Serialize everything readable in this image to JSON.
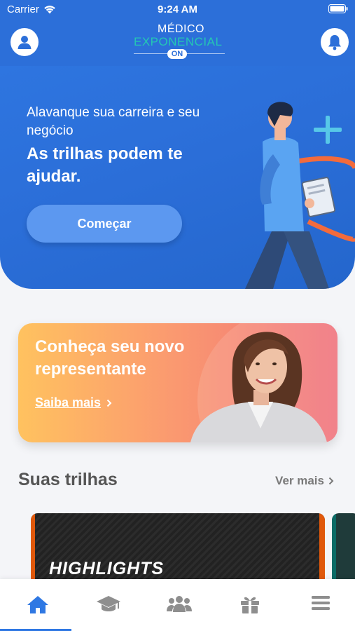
{
  "status_bar": {
    "carrier": "Carrier",
    "time": "9:24 AM"
  },
  "header": {
    "logo": {
      "line1": "MÉDICO",
      "line2": "EXPONENCIAL",
      "badge": "ON"
    },
    "colors": {
      "primary": "#2f78e3",
      "logo_accent": "#24c7b4"
    }
  },
  "hero": {
    "subtitle": "Alavanque sua carreira e seu negócio",
    "title": "As trilhas podem te ajudar.",
    "cta_label": "Começar"
  },
  "promo": {
    "title": "Conheça seu novo representante",
    "link_label": "Saiba mais"
  },
  "tracks": {
    "section_title": "Suas trilhas",
    "see_more_label": "Ver mais",
    "cards": [
      {
        "label": "HIGHLIGHTS"
      }
    ]
  },
  "tabbar": {
    "active_index": 0,
    "items": [
      {
        "icon": "home-icon"
      },
      {
        "icon": "graduation-cap-icon"
      },
      {
        "icon": "users-icon"
      },
      {
        "icon": "gift-icon"
      },
      {
        "icon": "menu-icon"
      }
    ],
    "colors": {
      "active": "#2f78e3",
      "inactive": "#8e8e8e"
    }
  }
}
